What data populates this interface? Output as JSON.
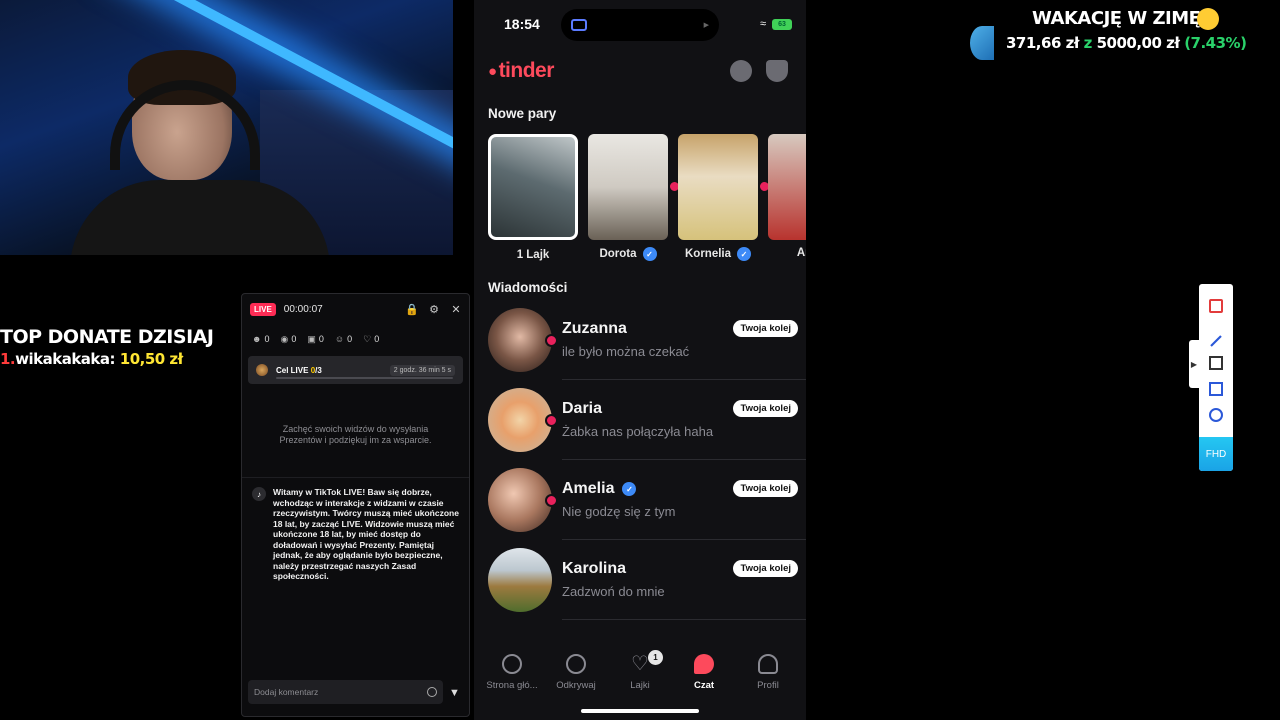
{
  "donate": {
    "title": "TOP DONATE DZISIAJ",
    "rank": "1.",
    "donor": "wikakakaka:",
    "amount": "10,50 zł"
  },
  "live_panel": {
    "badge": "LIVE",
    "timer": "00:00:07",
    "stats": [
      "0",
      "0",
      "0",
      "0",
      "0"
    ],
    "goal": {
      "label_prefix": "Cel LIVE ",
      "current": "0",
      "total": "/3",
      "time_left": "2 godz. 36 min 5 s",
      "progress": 0
    },
    "gift_hint": "Zachęć swoich widzów do wysyłania Prezentów i podziękuj im za wsparcie.",
    "welcome": "Witamy w TikTok LIVE! Baw się dobrze, wchodząc w interakcje z widzami w czasie rzeczywistym. Twórcy muszą mieć ukończone 18 lat, by zacząć LIVE. Widzowie muszą mieć ukończone 18 lat, by mieć dostęp do doładowań i wysyłać Prezenty. Pamiętaj jednak, że aby oglądanie było bezpieczne, należy przestrzegać naszych Zasad społeczności.",
    "comment_placeholder": "Dodaj komentarz"
  },
  "phone": {
    "time": "18:54",
    "battery": "63",
    "brand": "tinder",
    "new_pairs_title": "Nowe pary",
    "matches": [
      {
        "name": "1 Lajk",
        "verified": false
      },
      {
        "name": "Dorota",
        "verified": true
      },
      {
        "name": "Kornelia",
        "verified": true
      },
      {
        "name": "And",
        "verified": false
      }
    ],
    "messages_title": "Wiadomości",
    "turn_label": "Twoja kolej",
    "messages": [
      {
        "name": "Zuzanna",
        "last": "ile było można czekać",
        "verified": false
      },
      {
        "name": "Daria",
        "last": "Żabka nas połączyła haha",
        "verified": false
      },
      {
        "name": "Amelia",
        "last": "Nie godzę się z tym",
        "verified": true
      },
      {
        "name": "Karolina",
        "last": "Zadzwoń do mnie",
        "verified": false
      }
    ],
    "tabs": [
      {
        "label": "Strona głó...",
        "icon": "flame-icon"
      },
      {
        "label": "Odkrywaj",
        "icon": "compass-icon"
      },
      {
        "label": "Lajki",
        "icon": "heart-icon",
        "badge": "1"
      },
      {
        "label": "Czat",
        "icon": "chat-icon",
        "active": true
      },
      {
        "label": "Profil",
        "icon": "person-icon"
      }
    ]
  },
  "goal_overlay": {
    "title": "WAKACJĘ W ZIMĘ",
    "current": "371,66 zł",
    "sep": "z",
    "target": "5000,00 zł",
    "percent": "(7.43%)"
  },
  "toolbar": {
    "quality": "FHD"
  },
  "colors": {
    "tinder_red": "#fd4a5c",
    "live_pink": "#fe2c55",
    "donate_yellow": "#ffe633",
    "progress_green": "#2ad16a"
  }
}
